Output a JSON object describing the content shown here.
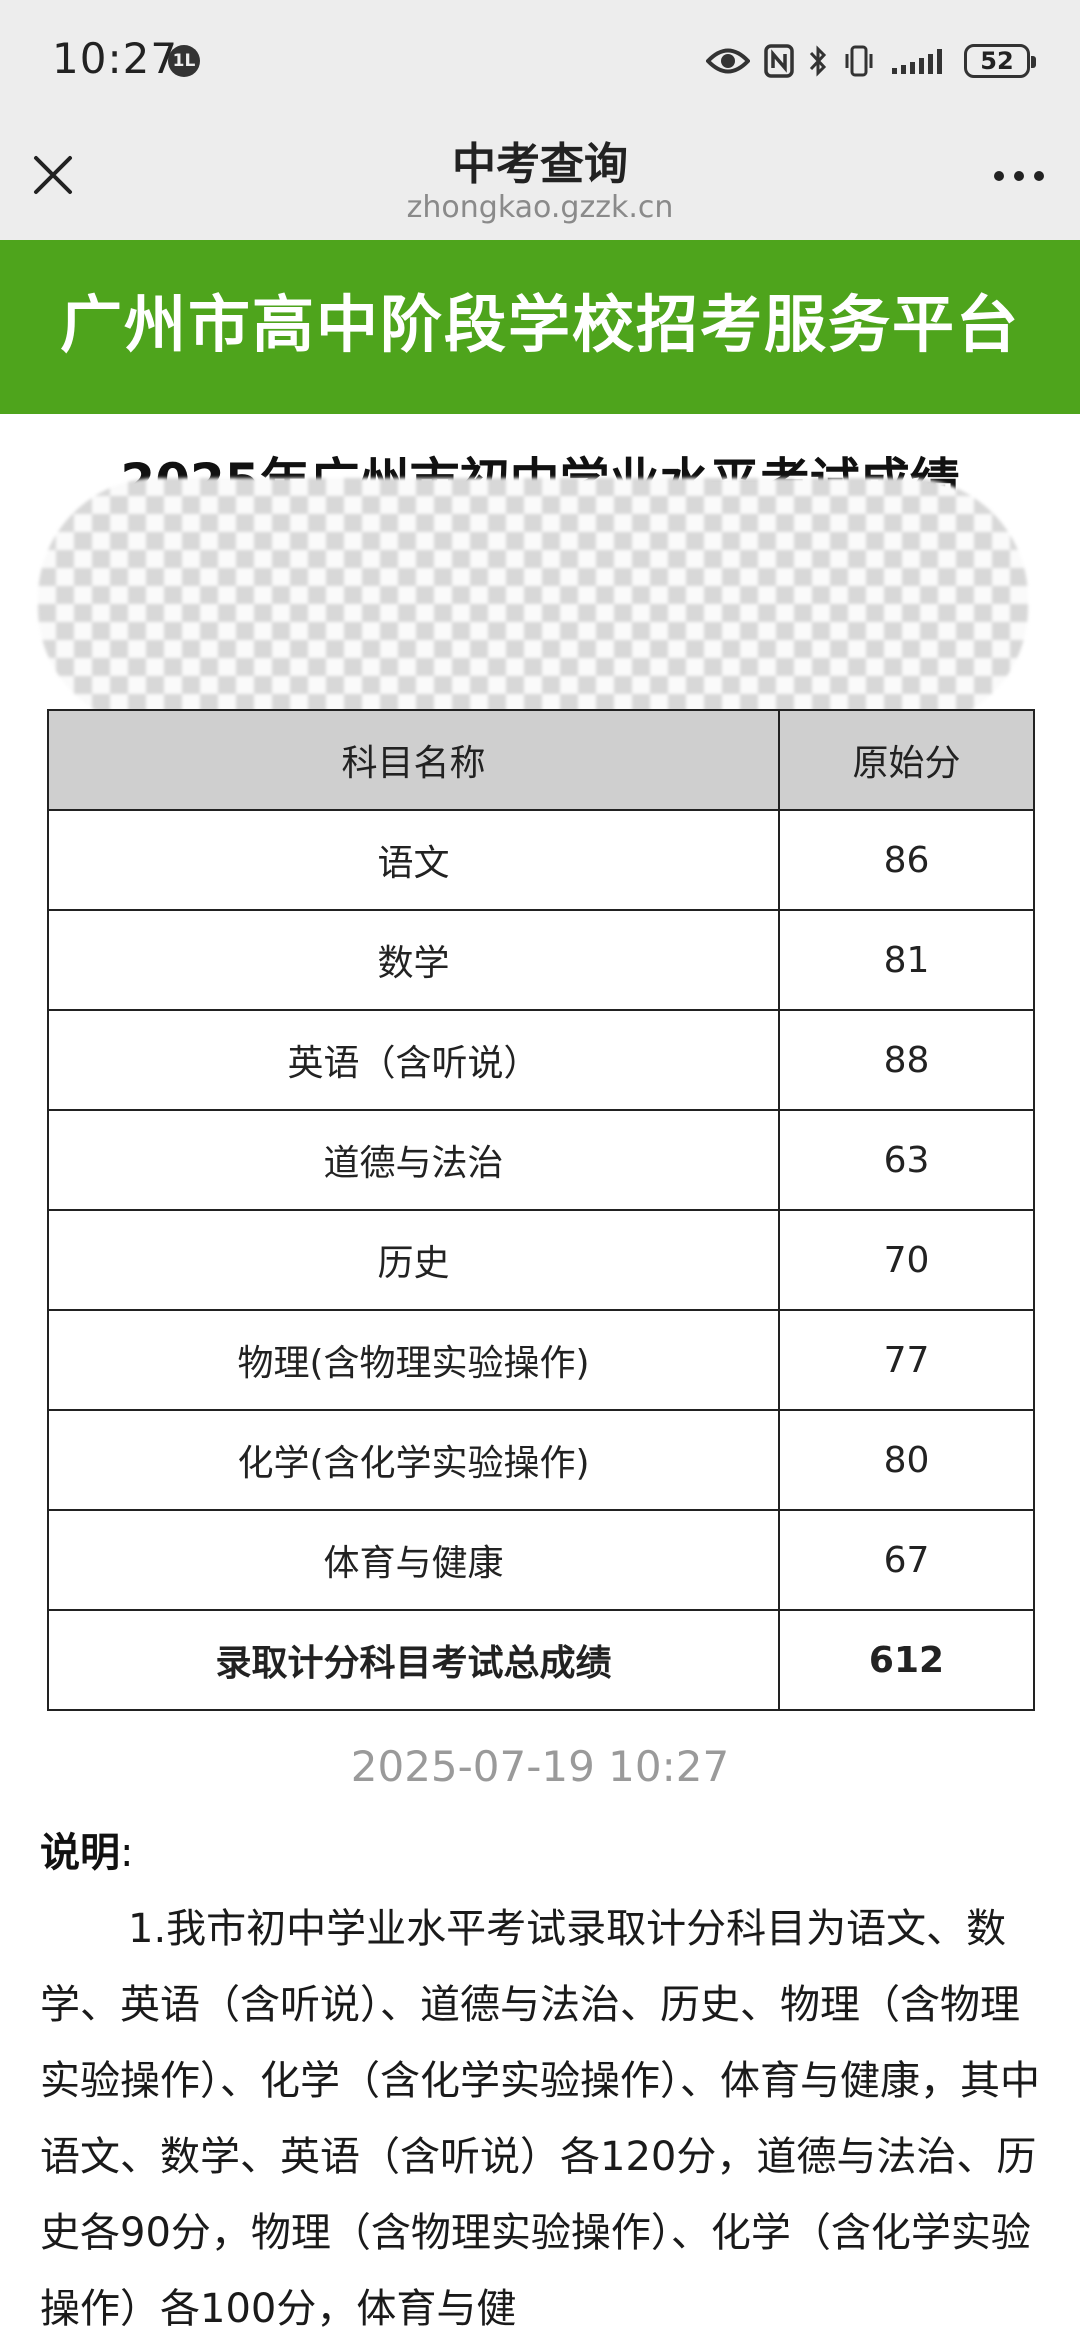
{
  "status_bar": {
    "time": "10:27",
    "time_badge": "1L",
    "battery": "52",
    "icons": [
      "eye-icon",
      "nfc-icon",
      "bluetooth-icon",
      "vibrate-icon",
      "signal-icon",
      "battery-icon"
    ]
  },
  "nav": {
    "title": "中考查询",
    "url": "zhongkao.gzzk.cn"
  },
  "banner": {
    "text": "广州市高中阶段学校招考服务平台"
  },
  "page_heading": "2025年广州市初中学业水平考试成绩",
  "table": {
    "headers": [
      "科目名称",
      "原始分"
    ],
    "rows": [
      {
        "subject": "语文",
        "score": "86"
      },
      {
        "subject": "数学",
        "score": "81"
      },
      {
        "subject": "英语（含听说）",
        "score": "88"
      },
      {
        "subject": "道德与法治",
        "score": "63"
      },
      {
        "subject": "历史",
        "score": "70"
      },
      {
        "subject": "物理(含物理实验操作)",
        "score": "77"
      },
      {
        "subject": "化学(含化学实验操作)",
        "score": "80"
      },
      {
        "subject": "体育与健康",
        "score": "67"
      }
    ],
    "total": {
      "subject": "录取计分科目考试总成绩",
      "score": "612"
    }
  },
  "timestamp": "2025-07-19 10:27",
  "notes": {
    "heading": "说明",
    "heading_suffix": ":",
    "paragraph": "1.我市初中学业水平考试录取计分科目为语文、数学、英语（含听说）、道德与法治、历史、物理（含物理实验操作）、化学（含化学实验操作）、体育与健康，其中语文、数学、英语（含听说）各120分，道德与法治、历史各90分，物理（含物理实验操作）、化学（含化学实验操作）各100分，体育与健"
  },
  "colors": {
    "banner": "#4ea41c",
    "bar_bg": "#ededed",
    "header_cell": "#cfcfcf"
  }
}
